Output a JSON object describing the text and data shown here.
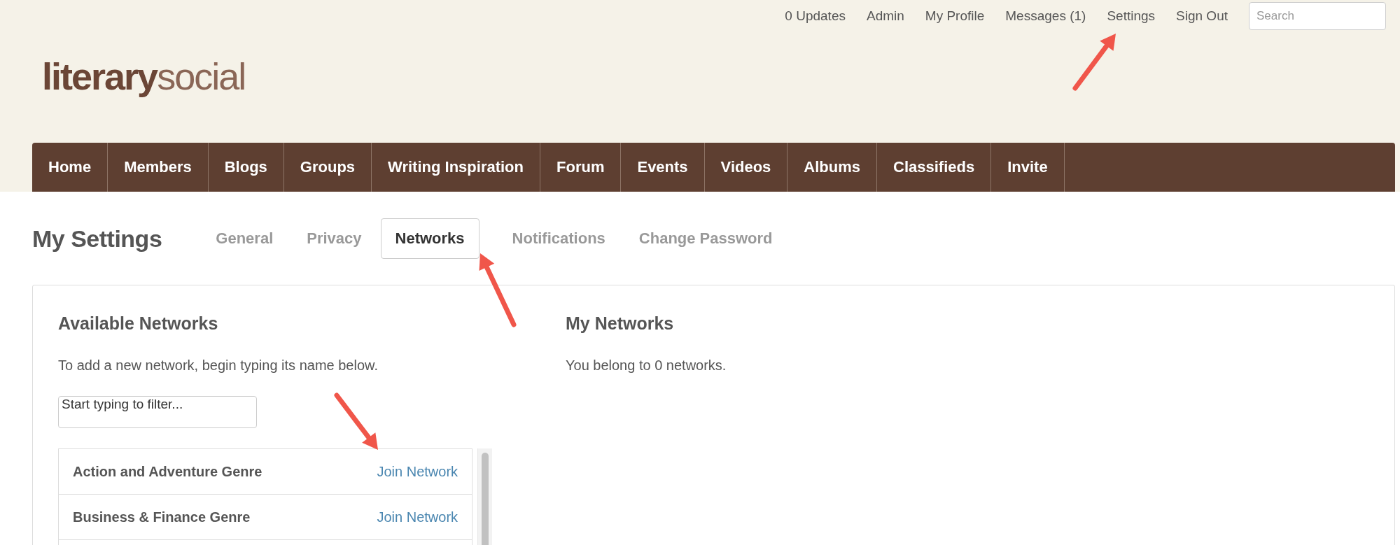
{
  "top_links": [
    "0 Updates",
    "Admin",
    "My Profile",
    "Messages (1)",
    "Settings",
    "Sign Out"
  ],
  "search": {
    "placeholder": "Search"
  },
  "logo": {
    "bold": "literary",
    "light": "social"
  },
  "nav": [
    "Home",
    "Members",
    "Blogs",
    "Groups",
    "Writing Inspiration",
    "Forum",
    "Events",
    "Videos",
    "Albums",
    "Classifieds",
    "Invite"
  ],
  "page_title": "My Settings",
  "tabs": [
    {
      "label": "General",
      "selected": false
    },
    {
      "label": "Privacy",
      "selected": false
    },
    {
      "label": "Networks",
      "selected": true
    },
    {
      "label": "Notifications",
      "selected": false
    },
    {
      "label": "Change Password",
      "selected": false
    }
  ],
  "available": {
    "heading": "Available Networks",
    "hint": "To add a new network, begin typing its name below.",
    "filter": {
      "value": "Start typing to filter..."
    },
    "networks": [
      {
        "name": "Action and Adventure Genre",
        "action": "Join Network"
      },
      {
        "name": "Business & Finance Genre",
        "action": "Join Network"
      }
    ]
  },
  "mine": {
    "heading": "My Networks",
    "text": "You belong to 0 networks."
  }
}
